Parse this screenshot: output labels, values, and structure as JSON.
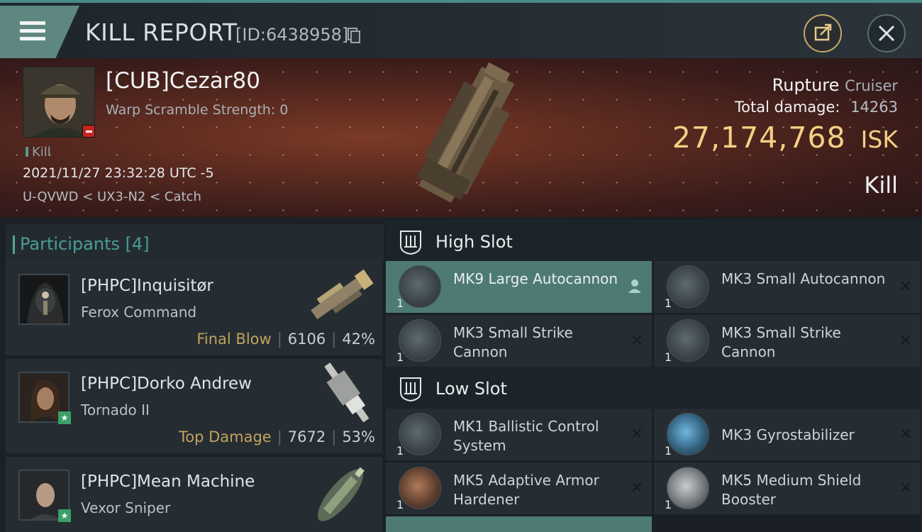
{
  "header": {
    "title": "KILL REPORT",
    "report_id": "[ID:6438958]"
  },
  "victim": {
    "name": "[CUB]Cezar80",
    "scramble": "Warp Scramble Strength: 0",
    "kill_tag": "Kill",
    "datetime": "2021/11/27 23:32:28 UTC -5",
    "location": "U-QVWD < UX3-N2 < Catch",
    "ship_name": "Rupture",
    "ship_class": "Cruiser",
    "total_damage_label": "Total damage:",
    "total_damage": "14263",
    "isk_value": "27,174,768",
    "isk_unit": "ISK",
    "result": "Kill"
  },
  "participants": {
    "title": "Participants",
    "count": "[4]",
    "items": [
      {
        "name": "[PHPC]Inquisitør",
        "ship": "Ferox Command",
        "tag": "Final Blow",
        "damage": "6106",
        "percent": "42%"
      },
      {
        "name": "[PHPC]Dorko Andrew",
        "ship": "Tornado II",
        "tag": "Top Damage",
        "damage": "7672",
        "percent": "53%"
      },
      {
        "name": "[PHPC]Mean Machine",
        "ship": "Vexor Sniper"
      }
    ]
  },
  "fitting": {
    "high_slot": {
      "title": "High Slot",
      "modules": [
        {
          "name": "MK9 Large Autocannon",
          "qty": "1"
        },
        {
          "name": "MK3 Small Autocannon",
          "qty": "1"
        },
        {
          "name": "MK3 Small Strike Cannon",
          "qty": "1"
        },
        {
          "name": "MK3 Small Strike Cannon",
          "qty": "1"
        }
      ]
    },
    "low_slot": {
      "title": "Low Slot",
      "modules": [
        {
          "name": "MK1 Ballistic Control System",
          "qty": "1"
        },
        {
          "name": "MK3 Gyrostabilizer",
          "qty": "1"
        },
        {
          "name": "MK5 Adaptive Armor Hardener",
          "qty": "1"
        },
        {
          "name": "MK5 Medium Shield Booster",
          "qty": "1"
        }
      ]
    }
  },
  "icons": {
    "menu": "menu-icon",
    "copy": "copy-icon",
    "share": "share-icon",
    "close": "close-icon",
    "remove": "x-icon",
    "pilot": "person-icon",
    "slot": "slot-icon"
  },
  "colors": {
    "accent_teal": "#4b9c96",
    "isk_gold": "#f5cf84",
    "highlight_row": "#4e7a76"
  }
}
